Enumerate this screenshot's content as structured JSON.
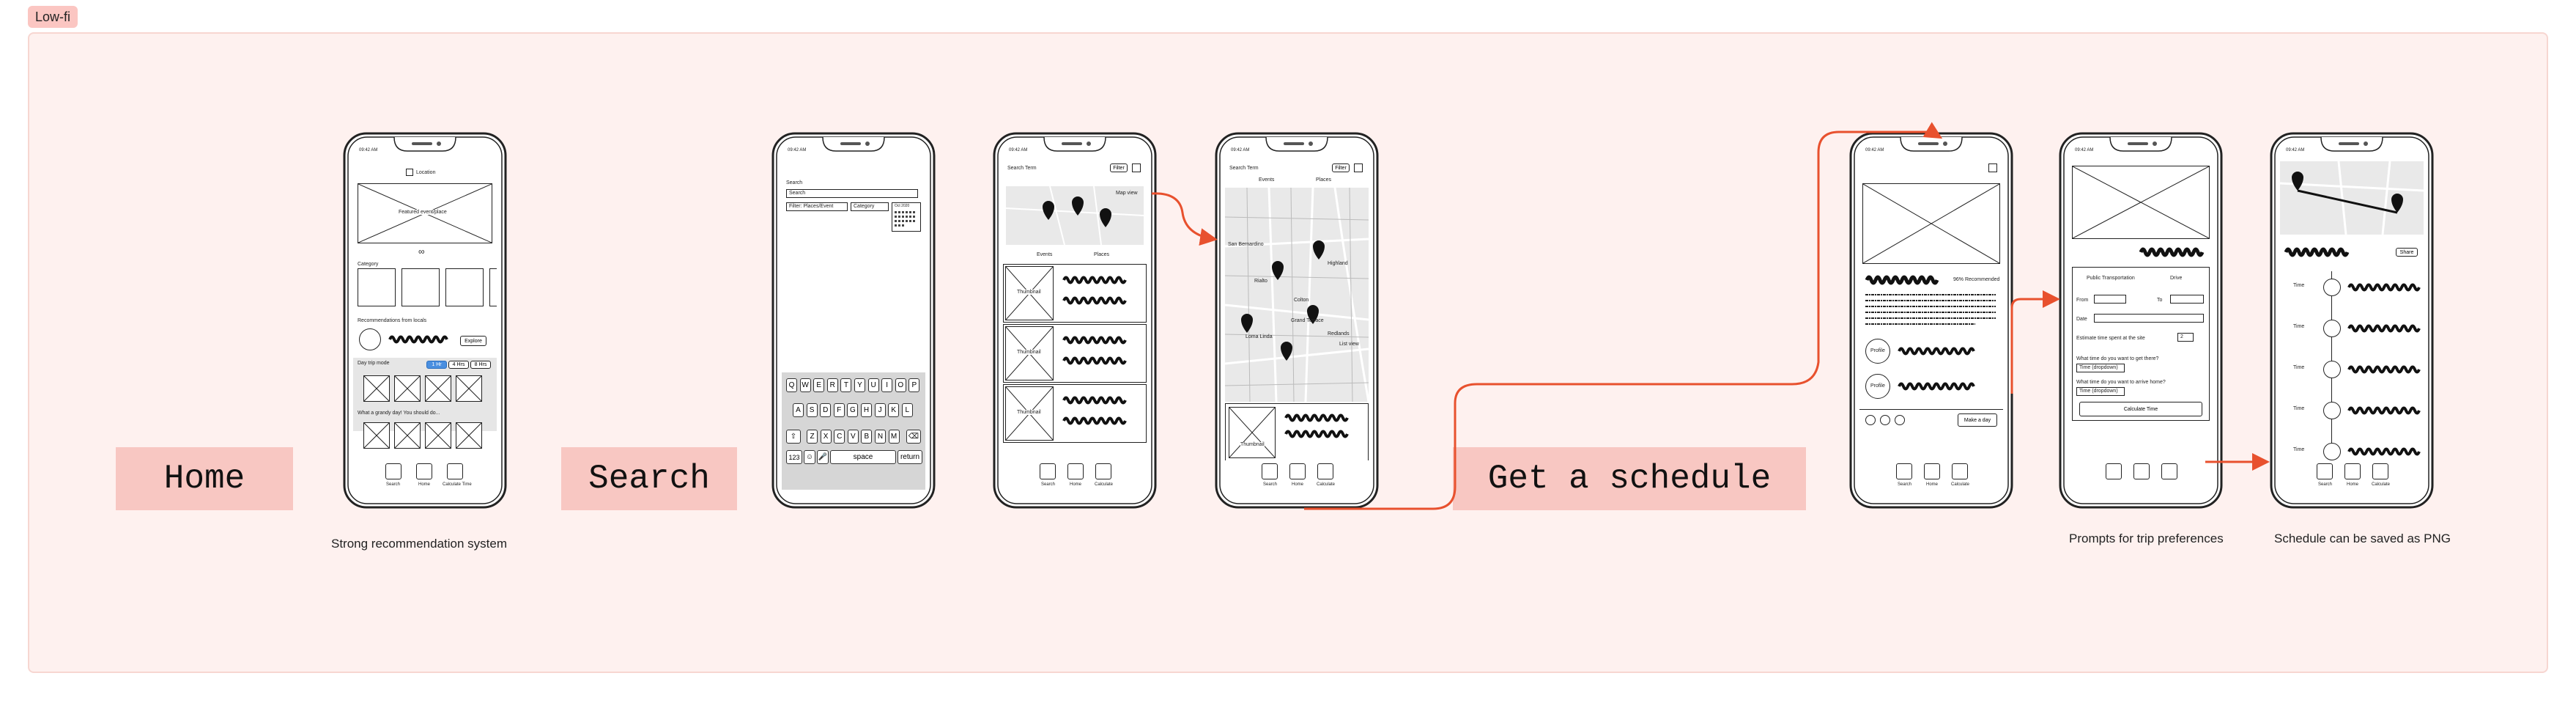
{
  "badge": "Low-fi",
  "sections": {
    "home": "Home",
    "search": "Search",
    "schedule": "Get a schedule"
  },
  "captions": {
    "home": "Strong recommendation system",
    "trip": "Prompts for trip preferences",
    "saved": "Schedule can be saved as PNG"
  },
  "phones": {
    "status_time": "09:42 AM",
    "home": {
      "location": "Location",
      "featured": "Featured event/place",
      "dots": "∞",
      "category": "Category",
      "recommendations": "Recommendations from locals",
      "explore": "Explore",
      "daytrip": "Day trip mode",
      "daytrip_opts": [
        "1 Hr",
        "4 Hrs",
        "8 Hrs"
      ],
      "guess": "What a grandy day! You should do..."
    },
    "search": {
      "search_label": "Search",
      "search_value": "Search",
      "filter": "Filter: Places/Event",
      "category": "Category",
      "calendar_title": "Oct 2020",
      "keys_row1": [
        "Q",
        "W",
        "E",
        "R",
        "T",
        "Y",
        "U",
        "I",
        "O",
        "P"
      ],
      "keys_row2": [
        "A",
        "S",
        "D",
        "F",
        "G",
        "H",
        "J",
        "K",
        "L"
      ],
      "keys_row3": [
        "Z",
        "X",
        "C",
        "V",
        "B",
        "N",
        "M"
      ],
      "key_123": "123",
      "key_space": "space",
      "key_return": "return"
    },
    "results": {
      "search_term": "Search Term",
      "filter": "Filter",
      "map_view": "Map view",
      "events": "Events",
      "places": "Places",
      "thumbnail": "Thumbnail"
    },
    "mapview": {
      "search_term": "Search Term",
      "filter": "Filter",
      "events": "Events",
      "places": "Places",
      "list_view": "List view",
      "thumbnail": "Thumbnail",
      "map_labels": [
        "San Bernardino",
        "Loma Linda",
        "Redlands",
        "Highland",
        "Rialto",
        "Colton",
        "Grand Terrace"
      ]
    },
    "detail": {
      "recommended": "96% Recommended",
      "profile": "Profile",
      "make_day": "Make a day"
    },
    "prefs": {
      "public_transport": "Public Transportation",
      "drive": "Drive",
      "from": "From",
      "to": "To",
      "date": "Date",
      "estimate": "Estimate time spent at the site",
      "estimate_val": "2",
      "arrive_q": "What time do you want to get there?",
      "home_q": "What time do you want to arrive home?",
      "time_dropdown": "Time (dropdown)",
      "calculate": "Calculate Time"
    },
    "schedule": {
      "share": "Share",
      "time": "Time"
    },
    "tabs": {
      "search": "Search",
      "home": "Home",
      "calculate": "Calculate Time",
      "calc_short": "Calculate"
    }
  },
  "colors": {
    "board": "#fef1ef",
    "label": "#f8c7c2",
    "arrow": "#e8512e"
  }
}
